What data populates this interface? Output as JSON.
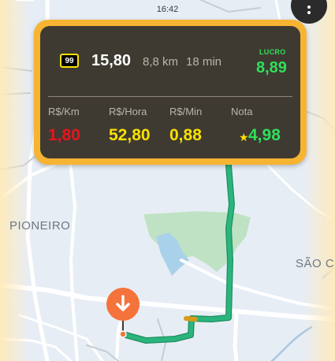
{
  "status_bar": {
    "time": "16:42"
  },
  "offer": {
    "badge": "99",
    "fare": "15,80",
    "distance": "8,8 km",
    "duration": "18 min",
    "profit_label": "LUCRO",
    "profit_value": "8,89"
  },
  "metrics": [
    {
      "label": "R$/Km",
      "value": "1,80",
      "color": "#e8141e"
    },
    {
      "label": "R$/Hora",
      "value": "52,80",
      "color": "#f9e100"
    },
    {
      "label": "R$/Min",
      "value": "0,88",
      "color": "#f9e100"
    },
    {
      "label": "Nota",
      "value": "4,98",
      "color": "#2fe05a"
    }
  ],
  "map": {
    "labels": [
      "PIONEIRO",
      "SÃO C"
    ]
  },
  "colors": {
    "card_border": "#f7b432",
    "card_background": "#3e3a31",
    "route": "#2ab57d",
    "pin": "#f4733b"
  },
  "icons": [
    "back-arrow-icon",
    "more-vert-icon",
    "arrow-down-icon",
    "star-icon"
  ]
}
